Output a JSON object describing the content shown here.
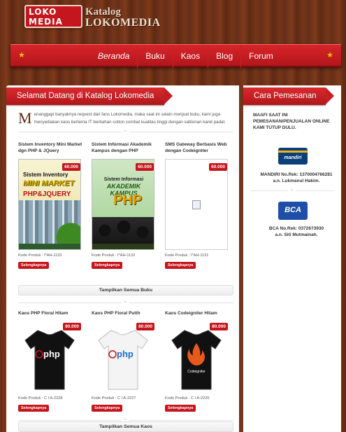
{
  "header": {
    "logo_line1": "LOKO",
    "logo_line2": "MEDIA",
    "brand_small": "Katalog",
    "brand_big": "LOKOMEDIA"
  },
  "nav": {
    "items": [
      "Beranda",
      "Buku",
      "Kaos",
      "Blog",
      "Forum"
    ]
  },
  "main": {
    "title": "Selamat Datang di Katalog Lokomedia",
    "intro_dropcap": "M",
    "intro_text": "enanggapi banyaknya request dari fans Lokomedia, maka saat ini selain menjual buku, kami juga menyediakan kaos bertema IT berbahan cotton combat kualitas tinggi dengan sablonan karet padat.",
    "books": [
      {
        "name": "Sistem Inventory Mini Market dgn PHP & JQuery",
        "price": "60.000",
        "code": "Kode Produk : I*AH-1133",
        "more": "Selengkapnya",
        "cover_title": "Sistem Inventory",
        "cover_sub": "MINI MARKET",
        "cover_tech": "PHP&JQUERY"
      },
      {
        "name": "Sistem Informasi Akademik Kampus dengan PHP",
        "price": "60.000",
        "code": "Kode Produk : I*AH-1132",
        "more": "Selengkapnya",
        "cover_title": "Sistem Informasi",
        "cover_sub": "AKADEMIK KAMPUS",
        "cover_tech": "PHP"
      },
      {
        "name": "SMS Gateway Berbasis Web dengan Codeigniter",
        "price": "60.000",
        "code": "Kode Produk : I*AH-1131",
        "more": "Selengkapnya"
      }
    ],
    "books_all": "Tampilkan Semua Buku",
    "shirts": [
      {
        "name": "Kaos PHP Floral Hitam",
        "price": "80.000",
        "code": "Kode Produk : C I A-2228",
        "more": "Selengkapnya",
        "logo": "php",
        "color": "#111111"
      },
      {
        "name": "Kaos PHP Floral Putih",
        "price": "80.000",
        "code": "Kode Produk : C I A-2227",
        "more": "Selengkapnya",
        "logo": "php",
        "color": "#f4f4f4"
      },
      {
        "name": "Kaos Codeigniter Hitam",
        "price": "80.000",
        "code": "Kode Produk : C I A-2226",
        "more": "Selengkapnya",
        "logo": "Codeigniter",
        "color": "#111111"
      }
    ],
    "shirts_all": "Tampilkan Semua Kaos"
  },
  "sidebar": {
    "title": "Cara Pemesanan",
    "notice": "MAAFI SAAT INI PEMESANAN/PENJUALAN ONLINE KAMI TUTUP DULU.",
    "banks": [
      {
        "logo": "mandiri",
        "line1": "MANDIRI No.Rek: 1370004766281",
        "line2": "a.n. Lukmanul Hakim.",
        "color": "#0a3f7a"
      },
      {
        "logo": "BCA",
        "line1": "BCA No.Rek: 0372673930",
        "line2": "a.n. Siti Mutmainah.",
        "color": "#1d4fa8"
      }
    ]
  },
  "colors": {
    "accent": "#c4161c",
    "wood": "#6a2f17"
  }
}
